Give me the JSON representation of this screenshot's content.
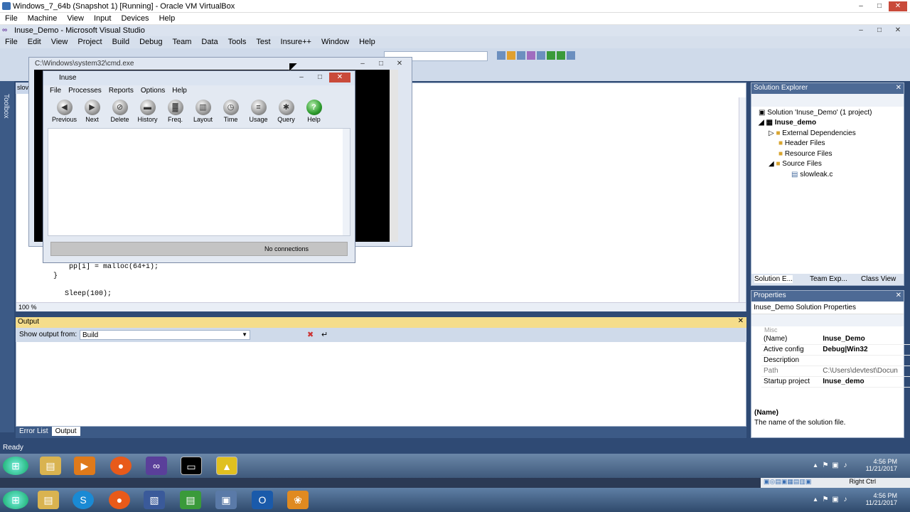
{
  "vbox": {
    "title": "Windows_7_64b (Snapshot 1) [Running] - Oracle VM VirtualBox",
    "menu": [
      "File",
      "Machine",
      "View",
      "Input",
      "Devices",
      "Help"
    ],
    "right_ctrl": "Right Ctrl"
  },
  "vs": {
    "title": "Inuse_Demo - Microsoft Visual Studio",
    "menu": [
      "File",
      "Edit",
      "View",
      "Project",
      "Build",
      "Debug",
      "Team",
      "Data",
      "Tools",
      "Test",
      "Insure++",
      "Window",
      "Help"
    ],
    "toolbox_label": "Toolbox",
    "editor_tab": "slov",
    "code_lines": [
      "pp[i] = malloc(64+i);",
      "}",
      "Sleep(100);"
    ],
    "zoom": "100 %",
    "output": {
      "title": "Output",
      "show_from_label": "Show output from:",
      "show_from_value": "Build"
    },
    "bottom_tabs": [
      "Error List",
      "Output"
    ],
    "status": "Ready",
    "solution_explorer": {
      "title": "Solution Explorer",
      "solution": "Solution 'Inuse_Demo' (1 project)",
      "project": "Inuse_demo",
      "folders": [
        "External Dependencies",
        "Header Files",
        "Resource Files",
        "Source Files"
      ],
      "file": "slowleak.c",
      "tabs": [
        "Solution E...",
        "Team Exp...",
        "Class View"
      ]
    },
    "properties": {
      "title": "Properties",
      "selector": "Inuse_Demo",
      "selector_suffix": "Solution Properties",
      "category": "Misc",
      "rows": [
        {
          "name": "(Name)",
          "value": "Inuse_Demo"
        },
        {
          "name": "Active config",
          "value": "Debug|Win32"
        },
        {
          "name": "Description",
          "value": ""
        },
        {
          "name": "Path",
          "value": "C:\\Users\\devtest\\Docun"
        },
        {
          "name": "Startup project",
          "value": "Inuse_demo"
        }
      ],
      "desc_title": "(Name)",
      "desc_text": "The name of the solution file."
    }
  },
  "cmd": {
    "title": "C:\\Windows\\system32\\cmd.exe"
  },
  "inuse": {
    "title": "Inuse",
    "menu": [
      "File",
      "Processes",
      "Reports",
      "Options",
      "Help"
    ],
    "toolbar": [
      "Previous",
      "Next",
      "Delete",
      "History",
      "Freq.",
      "Layout",
      "Time",
      "Usage",
      "Query",
      "Help"
    ],
    "status": "No connections"
  },
  "taskbar": {
    "inner_time": "4:56 PM",
    "inner_date": "11/21/2017",
    "outer_time": "4:56 PM",
    "outer_date": "11/21/2017"
  }
}
